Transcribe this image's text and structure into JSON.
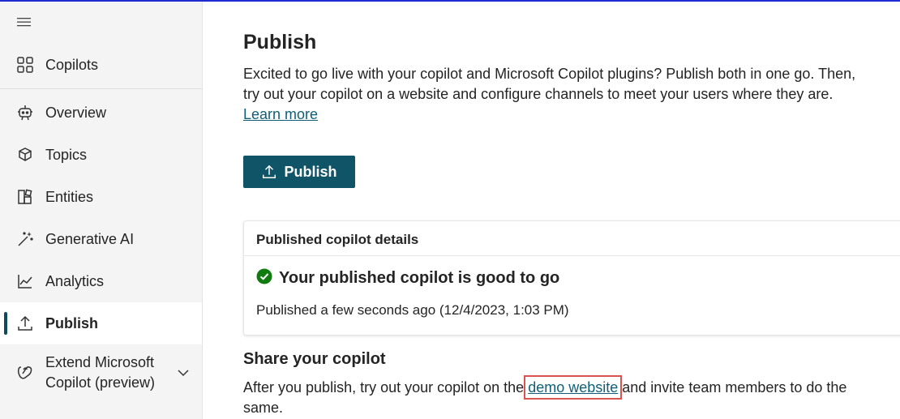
{
  "sidebar": {
    "items": [
      {
        "label": "Copilots",
        "icon": "grid-icon"
      },
      {
        "label": "Overview",
        "icon": "bot-icon"
      },
      {
        "label": "Topics",
        "icon": "topics-icon"
      },
      {
        "label": "Entities",
        "icon": "entities-icon"
      },
      {
        "label": "Generative AI",
        "icon": "wand-icon"
      },
      {
        "label": "Analytics",
        "icon": "chart-line-icon"
      },
      {
        "label": "Publish",
        "icon": "upload-icon"
      },
      {
        "label": "Extend Microsoft Copilot (preview)",
        "icon": "copilot-icon"
      }
    ],
    "active": "Publish"
  },
  "main": {
    "title": "Publish",
    "intro": "Excited to go live with your copilot and Microsoft Copilot plugins? Publish both in one go. Then, try out your copilot on a website and configure channels to meet your users where they are.",
    "learn_more": "Learn more",
    "publish_button": "Publish",
    "card": {
      "header": "Published copilot details",
      "status": "Your published copilot is good to go",
      "published_time": "Published a few seconds ago (12/4/2023, 1:03 PM)"
    },
    "share": {
      "title": "Share your copilot",
      "text_before": "After you publish, try out your copilot on the ",
      "link": "demo website",
      "text_after": " and invite team members to do the same."
    }
  },
  "colors": {
    "accent": "#0f5467",
    "success": "#107c10",
    "highlight": "#d9534f"
  }
}
